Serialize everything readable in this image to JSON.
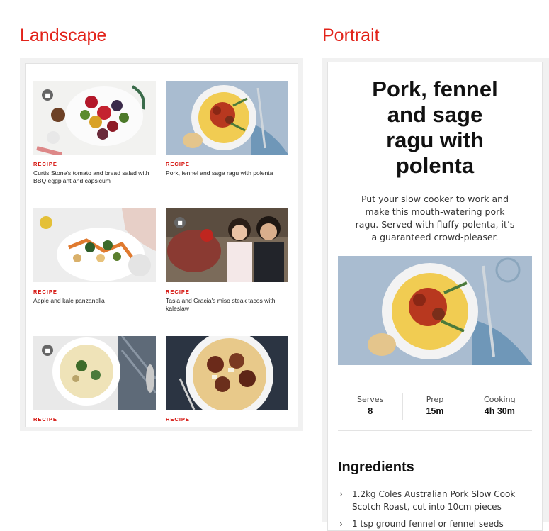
{
  "landscape": {
    "heading": "Landscape",
    "cards": [
      {
        "tag": "RECIPE",
        "title": "Curtis Stone's tomato and bread salad with BBQ eggplant and capsicum",
        "video": true
      },
      {
        "tag": "RECIPE",
        "title": "Pork, fennel and sage ragu with polenta",
        "video": false
      },
      {
        "tag": "RECIPE",
        "title": "Apple and kale panzanella",
        "video": false
      },
      {
        "tag": "RECIPE",
        "title": "Tasia and Gracia's miso steak tacos with kaleslaw",
        "video": true
      },
      {
        "tag": "RECIPE",
        "title": "",
        "video": true
      },
      {
        "tag": "RECIPE",
        "title": "",
        "video": false
      }
    ]
  },
  "portrait": {
    "heading": "Portrait",
    "title_lines": [
      "Pork, fennel",
      "and sage",
      "ragu with",
      "polenta"
    ],
    "intro": "Put your slow cooker to work and make this mouth-watering pork ragu. Served with fluffy polenta, it’s a guaranteed crowd-pleaser.",
    "stats": [
      {
        "label": "Serves",
        "value": "8"
      },
      {
        "label": "Prep",
        "value": "15m"
      },
      {
        "label": "Cooking",
        "value": "4h 30m"
      }
    ],
    "ingredients_title": "Ingredients",
    "ingredients": [
      "1.2kg Coles Australian Pork Slow Cook Scotch Roast, cut into 10cm pieces",
      "1 tsp ground fennel or fennel seeds"
    ]
  },
  "icons": {
    "video": "video-camera-icon",
    "chevron": "chevron-right-icon"
  },
  "colors": {
    "accent": "#e2231a",
    "tag": "#d5120c"
  }
}
